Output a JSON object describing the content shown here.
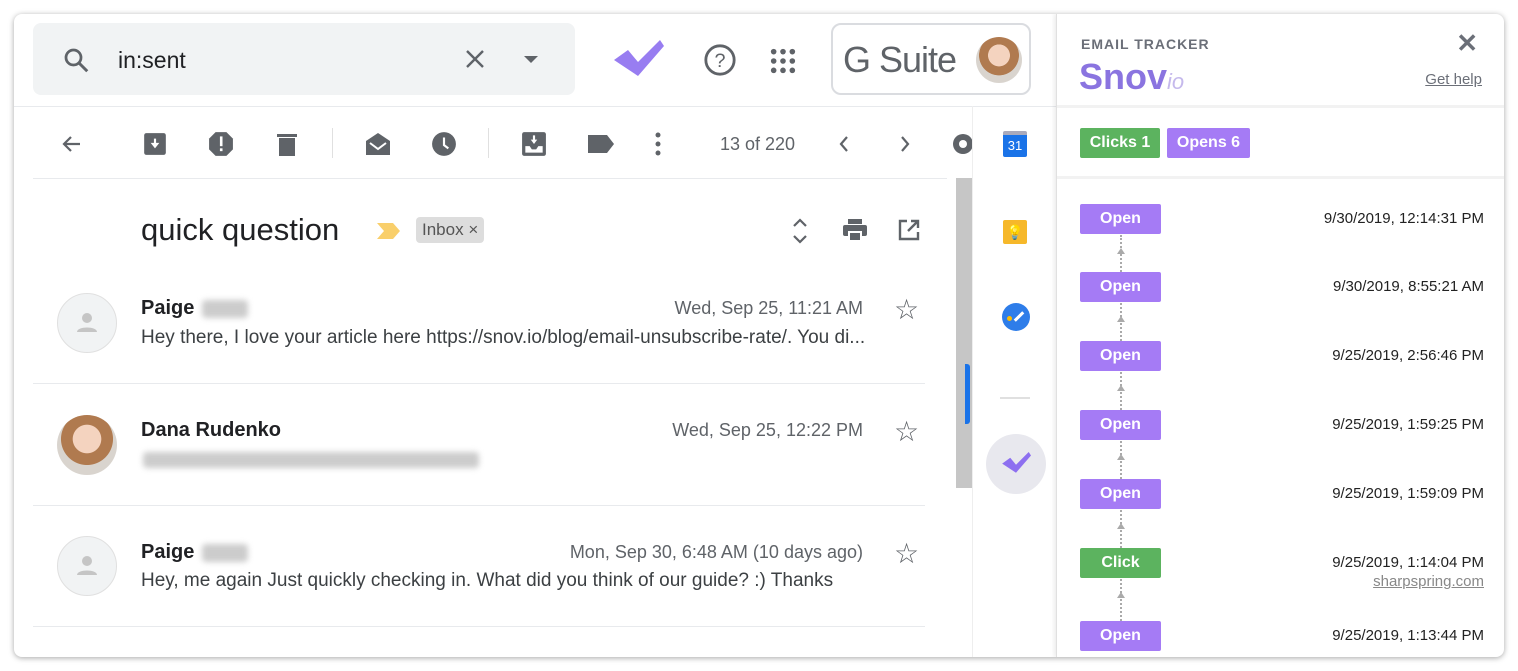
{
  "gmail": {
    "search": {
      "query": "in:sent"
    },
    "brand": "G Suite",
    "toolbar": {
      "count": "13 of 220"
    },
    "thread": {
      "subject": "quick question",
      "label": "Inbox",
      "label_close": "×"
    },
    "messages": [
      {
        "sender": "Paige",
        "date": "Wed, Sep 25, 11:21 AM",
        "snippet": "Hey there, I love your article here https://snov.io/blog/email-unsubscribe-rate/. You di...",
        "avatar": "generic"
      },
      {
        "sender": "Dana Rudenko",
        "date": "Wed, Sep 25, 12:22 PM",
        "snippet": "",
        "avatar": "photo"
      },
      {
        "sender": "Paige",
        "date": "Mon, Sep 30, 6:48 AM (10 days ago)",
        "snippet": "Hey, me again Just quickly checking in. What did you think of our guide? :) Thanks",
        "avatar": "generic"
      }
    ],
    "rail_icons": [
      "calendar-icon",
      "keep-icon",
      "tasks-icon",
      "snovio-icon"
    ],
    "calendar_day": "31"
  },
  "tracker": {
    "title": "EMAIL TRACKER",
    "logo_main": "Snov",
    "logo_sub": "io",
    "help": "Get help",
    "close": "✕",
    "summary": {
      "clicks": "Clicks 1",
      "opens": "Opens 6"
    },
    "events": [
      {
        "type": "Open",
        "time": "9/30/2019, 12:14:31 PM"
      },
      {
        "type": "Open",
        "time": "9/30/2019, 8:55:21 AM"
      },
      {
        "type": "Open",
        "time": "9/25/2019, 2:56:46 PM"
      },
      {
        "type": "Open",
        "time": "9/25/2019, 1:59:25 PM"
      },
      {
        "type": "Open",
        "time": "9/25/2019, 1:59:09 PM"
      },
      {
        "type": "Click",
        "time": "9/25/2019, 1:14:04 PM",
        "link": "sharpspring.com"
      },
      {
        "type": "Open",
        "time": "9/25/2019, 1:13:44 PM"
      }
    ],
    "colors": {
      "open": "#a57bf5",
      "click": "#5cb35f",
      "brand": "#8a74e0"
    }
  }
}
